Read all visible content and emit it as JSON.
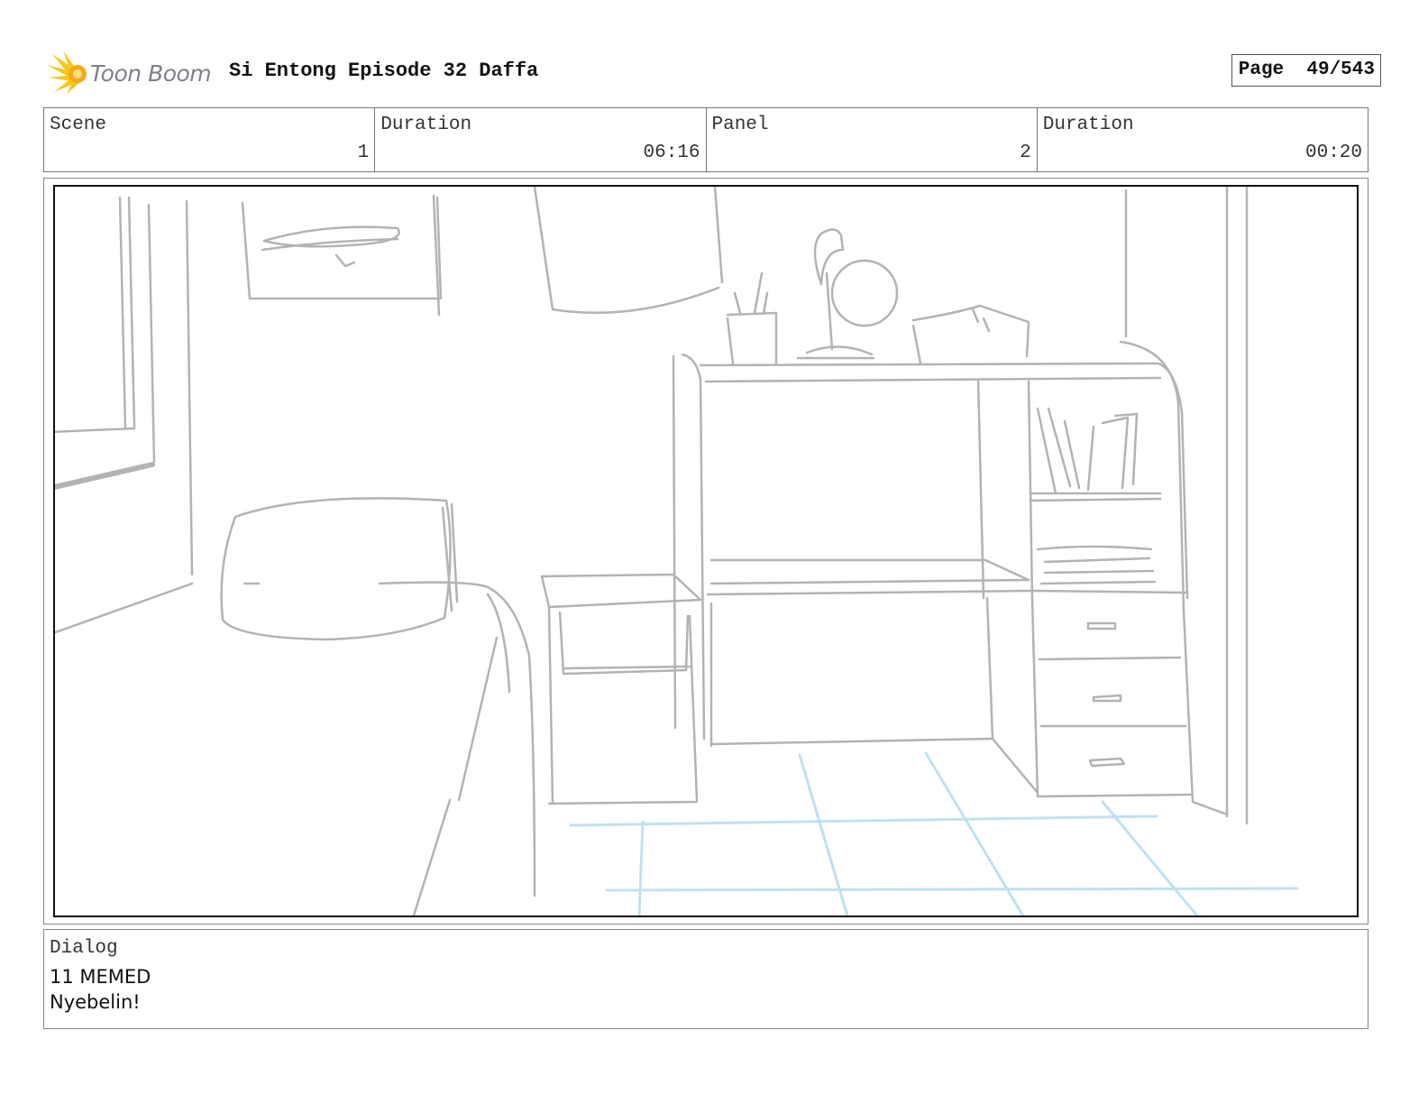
{
  "header": {
    "logo_text": "Toon Boom",
    "title": "Si Entong Episode 32 Daffa",
    "page_label": "Page",
    "page_value": "49/543"
  },
  "info": {
    "scene_label": "Scene",
    "scene_value": "1",
    "scene_duration_label": "Duration",
    "scene_duration_value": "06:16",
    "panel_label": "Panel",
    "panel_value": "2",
    "panel_duration_label": "Duration",
    "panel_duration_value": "00:20"
  },
  "dialog": {
    "label": "Dialog",
    "speaker": "11 MEMED",
    "line": "Nyebelin!"
  },
  "colors": {
    "sketch": "#b3b3b3",
    "floor_lines": "#bfe1f2",
    "logo_yellow": "#f7c61b"
  }
}
